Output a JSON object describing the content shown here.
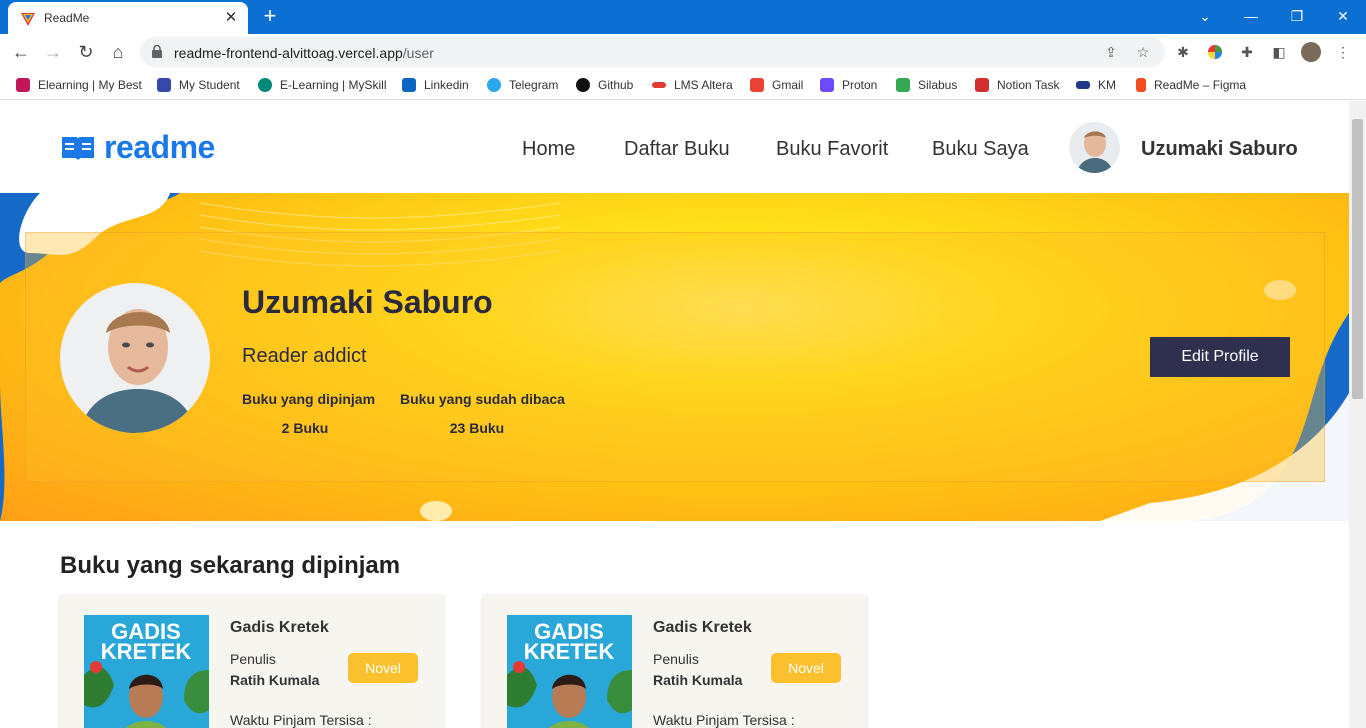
{
  "browser": {
    "tab_title": "ReadMe",
    "url_host": "readme-frontend-alvittoag.vercel.app",
    "url_path": "/user",
    "bookmarks": [
      {
        "label": "Elearning | My Best",
        "color": "#c2185b"
      },
      {
        "label": "My Student",
        "color": "#3949ab"
      },
      {
        "label": "E-Learning | MySkill",
        "color": "#00897b"
      },
      {
        "label": "Linkedin",
        "color": "#0a66c2"
      },
      {
        "label": "Telegram",
        "color": "#29a9eb"
      },
      {
        "label": "Github",
        "color": "#111111"
      },
      {
        "label": "LMS Altera",
        "color": "#e53935"
      },
      {
        "label": "Gmail",
        "color": "#ea4335"
      },
      {
        "label": "Proton",
        "color": "#6d4aff"
      },
      {
        "label": "Silabus",
        "color": "#34a853"
      },
      {
        "label": "Notion Task",
        "color": "#d32f2f"
      },
      {
        "label": "KM",
        "color": "#1e3a8a"
      },
      {
        "label": "ReadMe – Figma",
        "color": "#f24e1e"
      }
    ]
  },
  "nav": {
    "logo": "readme",
    "links": [
      "Home",
      "Daftar Buku",
      "Buku Favorit",
      "Buku Saya"
    ],
    "user_name": "Uzumaki Saburo"
  },
  "profile": {
    "name": "Uzumaki Saburo",
    "bio": "Reader addict",
    "borrowed_label": "Buku yang dipinjam",
    "borrowed_value": "2 Buku",
    "read_label": "Buku yang sudah dibaca",
    "read_value": "23 Buku",
    "edit_button": "Edit Profile"
  },
  "section": {
    "title": "Buku yang sekarang dipinjam"
  },
  "books": [
    {
      "title": "Gadis Kretek",
      "author_label": "Penulis",
      "author": "Ratih Kumala",
      "genre": "Novel",
      "remaining_label": "Waktu Pinjam Tersisa :",
      "cover_title": "GADIS KRETEK"
    },
    {
      "title": "Gadis Kretek",
      "author_label": "Penulis",
      "author": "Ratih Kumala",
      "genre": "Novel",
      "remaining_label": "Waktu Pinjam Tersisa :",
      "cover_title": "GADIS KRETEK"
    }
  ],
  "colors": {
    "brand": "#1a79e6",
    "accent": "#fbc02d",
    "button_dark": "#2f2f4f"
  }
}
